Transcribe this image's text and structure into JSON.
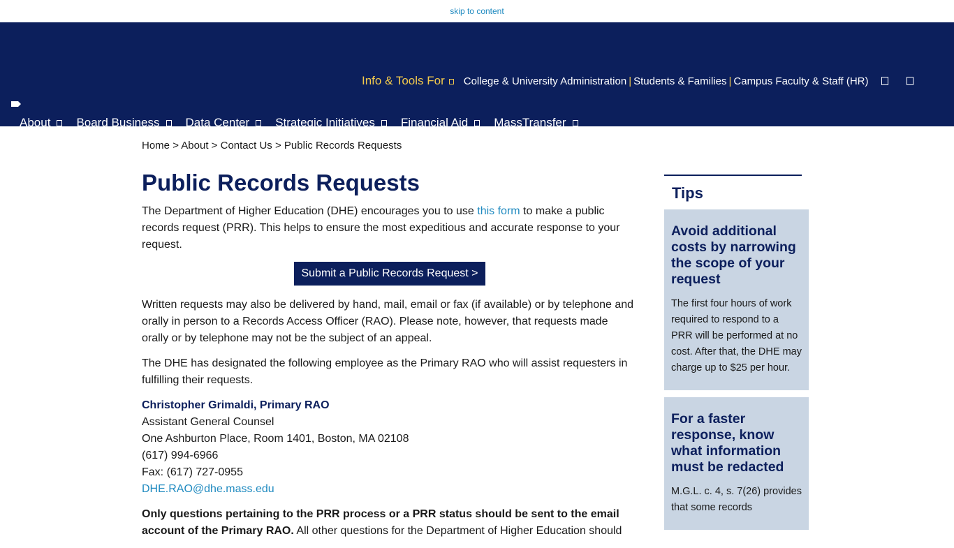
{
  "skip": {
    "label": "skip to content"
  },
  "header": {
    "tools_label": "Info & Tools For",
    "tools_links": [
      "College & University Administration",
      "Students & Families",
      "Campus Faculty & Staff (HR)"
    ],
    "separator": "|",
    "nav": [
      "About",
      "Board Business",
      "Data Center",
      "Strategic Initiatives",
      "Financial Aid",
      "MassTransfer"
    ]
  },
  "breadcrumb": {
    "items": [
      "Home",
      "About",
      "Contact Us",
      "Public Records Requests"
    ],
    "sep": ">"
  },
  "main": {
    "title": "Public Records Requests",
    "intro_before": "The Department of Higher Education (DHE) encourages you to use ",
    "intro_link": "this form",
    "intro_after": " to make a public records request (PRR). This helps to ensure the most expeditious and accurate response to your request.",
    "cta": "Submit a Public Records Request >",
    "para2": "Written requests may also be delivered by hand, mail, email or fax (if available) or by telephone and orally in person to a Records Access Officer (RAO). Please note, however, that requests made orally or by telephone may not be the subject of an appeal.",
    "para3": "The DHE has designated the following employee as the Primary RAO who will assist requesters in fulfilling their requests.",
    "contact": {
      "name": "Christopher Grimaldi, Primary RAO",
      "title": "Assistant General Counsel",
      "address": "One Ashburton Place, Room 1401, Boston, MA 02108",
      "phone": "(617) 994-6966",
      "fax": "Fax: (617) 727-0955",
      "email": "DHE.RAO@dhe.mass.edu"
    },
    "para4_bold": "Only questions pertaining to the PRR process or a PRR status should be sent to the email account of the Primary RAO.",
    "para4_rest": " All other questions for the Department of Higher Education should"
  },
  "aside": {
    "title": "Tips",
    "cards": [
      {
        "heading": "Avoid additional costs by narrowing the scope of your request",
        "body": "The first four hours of work required to respond to a PRR will be performed at no cost. After that, the DHE may charge up to $25 per hour."
      },
      {
        "heading": "For a faster response, know what information must be redacted",
        "body": "M.G.L. c. 4, s. 7(26) provides that some records"
      }
    ]
  },
  "colors": {
    "navy": "#0c1f5c",
    "link": "#1f8ac0",
    "gold": "#f2c94c",
    "tip_bg": "#c9d5e3"
  }
}
